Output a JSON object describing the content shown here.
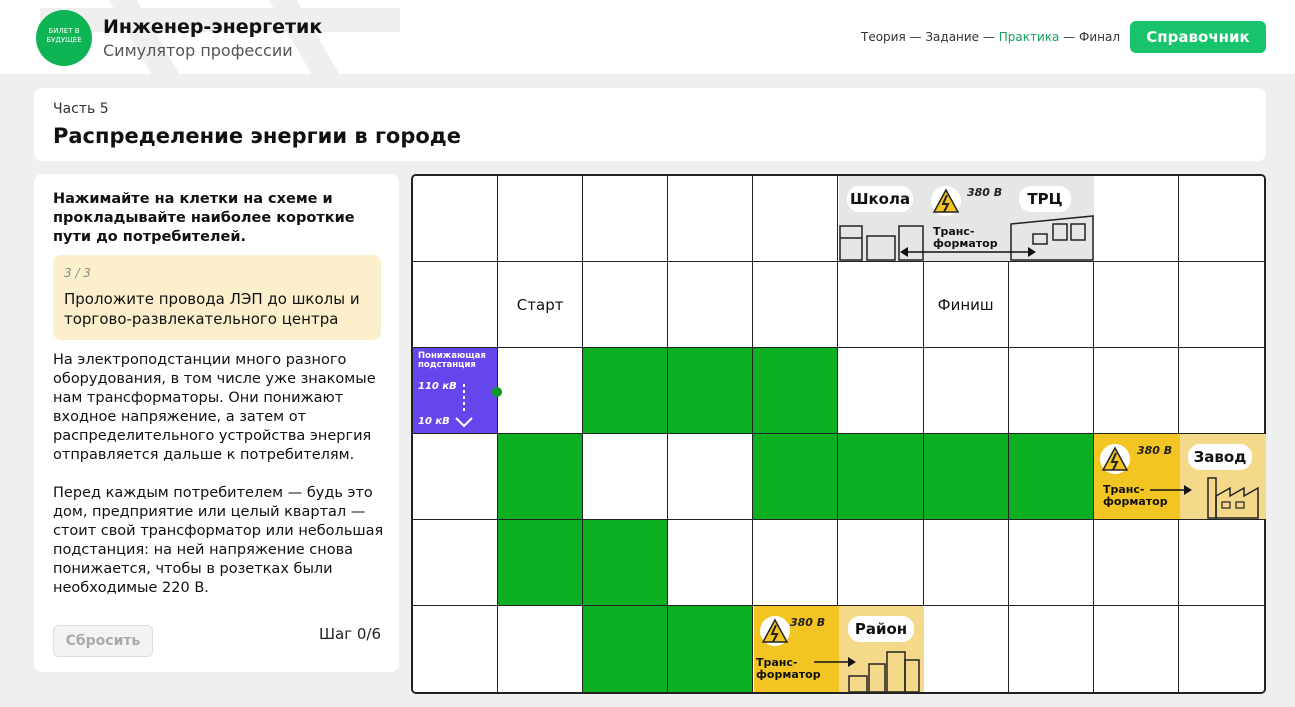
{
  "header": {
    "logo_text": "БИЛЕТ В БУДУЩЕЕ",
    "title": "Инженер-энергетик",
    "subtitle": "Симулятор профессии",
    "steps": [
      {
        "label": "Теория"
      },
      {
        "label": "Задание"
      },
      {
        "label": "Практика",
        "active": true
      },
      {
        "label": "Финал"
      }
    ],
    "sep": " — ",
    "ref_button": "Справочник"
  },
  "title_card": {
    "part": "Часть 5",
    "title": "Распределение энергии в городе"
  },
  "panel": {
    "instruction": "Нажимайте на клетки на схеме и прокладывайте наиболее короткие пути до потребителей.",
    "task_count": "3 / 3",
    "task_text": "Проложите провода ЛЭП до школы и торгово-развлекательного центра",
    "body": "На электроподстанции много разного оборудования, в том числе уже знакомые нам трансформаторы. Они понижают входное напряжение, а затем от распределительного устройства энергия отправляется дальше к потребителям.\n\nПеред каждым потребителем — будь это дом, предприятие или целый квартал — стоит свой трансформатор или небольшая подстанция: на ней напряжение снова понижается, чтобы в розетках были необходимые 220 В.",
    "reset_button": "Сбросить",
    "step_counter": "Шаг 0/6"
  },
  "grid": {
    "rows": 6,
    "cols": 10,
    "filled_cells": [
      [
        3,
        3
      ],
      [
        3,
        4
      ],
      [
        3,
        5
      ],
      [
        4,
        2
      ],
      [
        4,
        5
      ],
      [
        4,
        6
      ],
      [
        4,
        7
      ],
      [
        4,
        8
      ],
      [
        5,
        2
      ],
      [
        5,
        3
      ],
      [
        6,
        3
      ],
      [
        6,
        4
      ]
    ],
    "fill_color": "#0cae22",
    "labels": {
      "start": "Старт",
      "finish": "Финиш"
    }
  },
  "substation": {
    "title": "Понижающая подстанция",
    "input_voltage": "110 кВ",
    "output_voltage": "10 кВ",
    "color": "#6545ec"
  },
  "distributor": {
    "voltage": "10 кВ"
  },
  "consumers": {
    "school": "Школа",
    "mall": "ТРЦ",
    "factory": "Завод",
    "district": "Район"
  },
  "transformers": {
    "voltage": "380 В",
    "label": "Транс-\nформатор"
  },
  "colors": {
    "accent": "#17c36b",
    "path": "#0cae22",
    "transformer": "#f2c523"
  }
}
